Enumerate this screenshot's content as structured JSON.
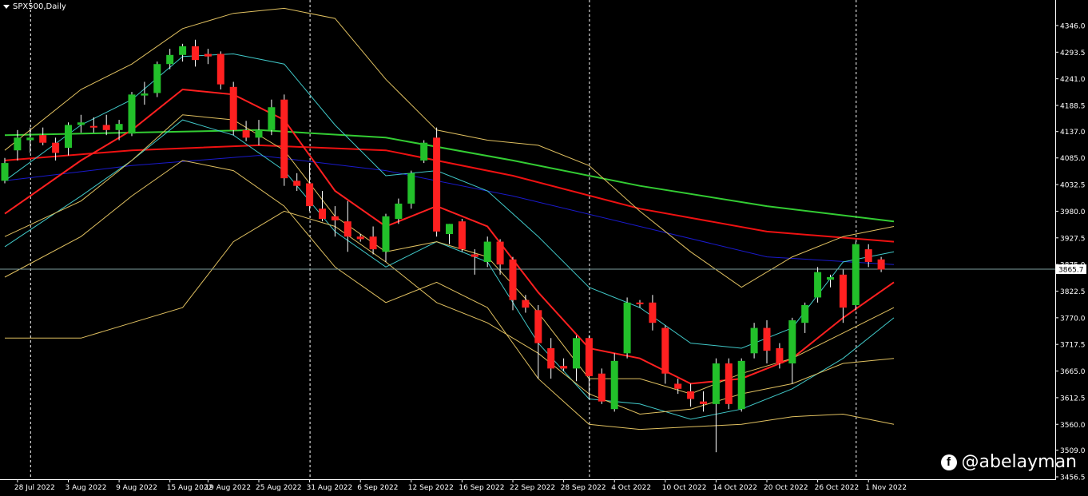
{
  "window": {
    "title": "SPX500,Daily"
  },
  "watermark": {
    "platform_icon": "facebook-icon",
    "handle": "@abelayman"
  },
  "colors": {
    "background": "#000000",
    "axis": "#ffffff",
    "grid": "#ffffff",
    "bull": "#22c02a",
    "bear": "#ff2020",
    "ma_green": "#33cc33",
    "ma_red": "#ee1111",
    "ma_blue": "#1a1acc",
    "bb_outer": "#e0c060",
    "bb_inner": "#40c8c8",
    "bb_mid": "#ff2020",
    "price_line": "#7fa0a0"
  },
  "chart_data": {
    "type": "candlestick",
    "symbol": "SPX500",
    "timeframe": "Daily",
    "ylim": [
      3456.5,
      4390
    ],
    "y_ticks": [
      "4346.0",
      "4293.5",
      "4241.0",
      "4188.5",
      "4137.0",
      "4085.0",
      "4032.5",
      "3980.0",
      "3927.5",
      "3875.0",
      "3822.5",
      "3770.0",
      "3717.5",
      "3665.0",
      "3612.5",
      "3560.0",
      "3509.0",
      "3456.5"
    ],
    "current_price": "3865.7",
    "x_labels": [
      "28 Jul 2022",
      "3 Aug 2022",
      "9 Aug 2022",
      "15 Aug 2022",
      "19 Aug 2022",
      "25 Aug 2022",
      "31 Aug 2022",
      "6 Sep 2022",
      "12 Sep 2022",
      "16 Sep 2022",
      "22 Sep 2022",
      "28 Sep 2022",
      "4 Oct 2022",
      "10 Oct 2022",
      "14 Oct 2022",
      "20 Oct 2022",
      "26 Oct 2022",
      "1 Nov 2022"
    ],
    "x_label_bar_index": [
      1,
      5,
      9,
      13,
      16,
      20,
      24,
      28,
      32,
      36,
      40,
      44,
      48,
      52,
      56,
      60,
      64,
      68
    ],
    "period_separators_bar_index": [
      2,
      24,
      46,
      67
    ],
    "candles": [
      {
        "o": 4040,
        "h": 4085,
        "l": 4035,
        "c": 4075
      },
      {
        "o": 4100,
        "h": 4140,
        "l": 4080,
        "c": 4125
      },
      {
        "o": 4120,
        "h": 4145,
        "l": 4095,
        "c": 4125
      },
      {
        "o": 4130,
        "h": 4145,
        "l": 4110,
        "c": 4115
      },
      {
        "o": 4115,
        "h": 4125,
        "l": 4080,
        "c": 4095
      },
      {
        "o": 4105,
        "h": 4155,
        "l": 4090,
        "c": 4150
      },
      {
        "o": 4150,
        "h": 4170,
        "l": 4135,
        "c": 4155
      },
      {
        "o": 4148,
        "h": 4165,
        "l": 4135,
        "c": 4145
      },
      {
        "o": 4150,
        "h": 4170,
        "l": 4130,
        "c": 4140
      },
      {
        "o": 4140,
        "h": 4160,
        "l": 4120,
        "c": 4152
      },
      {
        "o": 4133,
        "h": 4215,
        "l": 4128,
        "c": 4210
      },
      {
        "o": 4208,
        "h": 4235,
        "l": 4190,
        "c": 4212
      },
      {
        "o": 4213,
        "h": 4275,
        "l": 4205,
        "c": 4270
      },
      {
        "o": 4270,
        "h": 4300,
        "l": 4260,
        "c": 4288
      },
      {
        "o": 4288,
        "h": 4310,
        "l": 4275,
        "c": 4305
      },
      {
        "o": 4305,
        "h": 4318,
        "l": 4265,
        "c": 4278
      },
      {
        "o": 4290,
        "h": 4300,
        "l": 4270,
        "c": 4285
      },
      {
        "o": 4290,
        "h": 4295,
        "l": 4220,
        "c": 4230
      },
      {
        "o": 4225,
        "h": 4235,
        "l": 4130,
        "c": 4140
      },
      {
        "o": 4140,
        "h": 4158,
        "l": 4118,
        "c": 4125
      },
      {
        "o": 4125,
        "h": 4160,
        "l": 4110,
        "c": 4140
      },
      {
        "o": 4140,
        "h": 4200,
        "l": 4130,
        "c": 4185
      },
      {
        "o": 4200,
        "h": 4210,
        "l": 4030,
        "c": 4045
      },
      {
        "o": 4040,
        "h": 4055,
        "l": 4020,
        "c": 4030
      },
      {
        "o": 4035,
        "h": 4075,
        "l": 3980,
        "c": 3990
      },
      {
        "o": 3985,
        "h": 4020,
        "l": 3960,
        "c": 3965
      },
      {
        "o": 3970,
        "h": 3990,
        "l": 3930,
        "c": 3962
      },
      {
        "o": 3960,
        "h": 4000,
        "l": 3900,
        "c": 3930
      },
      {
        "o": 3930,
        "h": 3935,
        "l": 3920,
        "c": 3925
      },
      {
        "o": 3930,
        "h": 3950,
        "l": 3895,
        "c": 3905
      },
      {
        "o": 3900,
        "h": 3975,
        "l": 3880,
        "c": 3970
      },
      {
        "o": 3965,
        "h": 4005,
        "l": 3955,
        "c": 3995
      },
      {
        "o": 3995,
        "h": 4060,
        "l": 3985,
        "c": 4055
      },
      {
        "o": 4080,
        "h": 4120,
        "l": 4075,
        "c": 4115
      },
      {
        "o": 4125,
        "h": 4145,
        "l": 3930,
        "c": 3940
      },
      {
        "o": 3935,
        "h": 3955,
        "l": 3915,
        "c": 3955
      },
      {
        "o": 3960,
        "h": 3965,
        "l": 3900,
        "c": 3905
      },
      {
        "o": 3895,
        "h": 3905,
        "l": 3855,
        "c": 3890
      },
      {
        "o": 3880,
        "h": 3930,
        "l": 3870,
        "c": 3920
      },
      {
        "o": 3920,
        "h": 3925,
        "l": 3855,
        "c": 3875
      },
      {
        "o": 3885,
        "h": 3890,
        "l": 3785,
        "c": 3805
      },
      {
        "o": 3805,
        "h": 3815,
        "l": 3780,
        "c": 3790
      },
      {
        "o": 3785,
        "h": 3795,
        "l": 3650,
        "c": 3720
      },
      {
        "o": 3710,
        "h": 3730,
        "l": 3650,
        "c": 3670
      },
      {
        "o": 3675,
        "h": 3690,
        "l": 3665,
        "c": 3670
      },
      {
        "o": 3670,
        "h": 3735,
        "l": 3645,
        "c": 3730
      },
      {
        "o": 3730,
        "h": 3735,
        "l": 3610,
        "c": 3655
      },
      {
        "o": 3660,
        "h": 3670,
        "l": 3600,
        "c": 3605
      },
      {
        "o": 3590,
        "h": 3700,
        "l": 3585,
        "c": 3685
      },
      {
        "o": 3700,
        "h": 3810,
        "l": 3690,
        "c": 3800
      },
      {
        "o": 3800,
        "h": 3805,
        "l": 3790,
        "c": 3798
      },
      {
        "o": 3800,
        "h": 3815,
        "l": 3745,
        "c": 3760
      },
      {
        "o": 3750,
        "h": 3755,
        "l": 3640,
        "c": 3660
      },
      {
        "o": 3640,
        "h": 3650,
        "l": 3620,
        "c": 3630
      },
      {
        "o": 3625,
        "h": 3640,
        "l": 3595,
        "c": 3610
      },
      {
        "o": 3605,
        "h": 3625,
        "l": 3585,
        "c": 3600
      },
      {
        "o": 3600,
        "h": 3690,
        "l": 3505,
        "c": 3680
      },
      {
        "o": 3680,
        "h": 3690,
        "l": 3590,
        "c": 3600
      },
      {
        "o": 3590,
        "h": 3690,
        "l": 3585,
        "c": 3685
      },
      {
        "o": 3700,
        "h": 3760,
        "l": 3690,
        "c": 3750
      },
      {
        "o": 3750,
        "h": 3765,
        "l": 3680,
        "c": 3705
      },
      {
        "o": 3710,
        "h": 3720,
        "l": 3670,
        "c": 3680
      },
      {
        "o": 3680,
        "h": 3770,
        "l": 3640,
        "c": 3765
      },
      {
        "o": 3760,
        "h": 3800,
        "l": 3740,
        "c": 3795
      },
      {
        "o": 3810,
        "h": 3870,
        "l": 3800,
        "c": 3860
      },
      {
        "o": 3845,
        "h": 3855,
        "l": 3830,
        "c": 3850
      },
      {
        "o": 3855,
        "h": 3865,
        "l": 3760,
        "c": 3790
      },
      {
        "o": 3795,
        "h": 3920,
        "l": 3785,
        "c": 3915
      },
      {
        "o": 3905,
        "h": 3915,
        "l": 3870,
        "c": 3880
      },
      {
        "o": 3885,
        "h": 3890,
        "l": 3860,
        "c": 3865
      }
    ],
    "indicators": {
      "ma_green": {
        "bars": [
          0,
          10,
          20,
          30,
          40,
          50,
          60,
          70
        ],
        "values": [
          4130,
          4135,
          4140,
          4125,
          4080,
          4030,
          3990,
          3960
        ]
      },
      "ma_red_long": {
        "bars": [
          0,
          10,
          20,
          30,
          40,
          50,
          60,
          70
        ],
        "values": [
          4080,
          4100,
          4110,
          4100,
          4050,
          3985,
          3940,
          3920
        ]
      },
      "ma_blue": {
        "bars": [
          0,
          10,
          20,
          30,
          40,
          50,
          60,
          70
        ],
        "values": [
          4040,
          4070,
          4090,
          4060,
          4010,
          3950,
          3890,
          3875
        ]
      },
      "bb_mid": {
        "bars": [
          0,
          6,
          10,
          14,
          18,
          22,
          26,
          30,
          34,
          38,
          42,
          46,
          50,
          54,
          58,
          62,
          66,
          70
        ],
        "values": [
          3975,
          4080,
          4140,
          4220,
          4210,
          4160,
          4020,
          3950,
          3990,
          3950,
          3820,
          3710,
          3690,
          3640,
          3650,
          3690,
          3770,
          3840
        ]
      },
      "bb_up_inner": {
        "bars": [
          0,
          6,
          10,
          14,
          18,
          22,
          26,
          30,
          34,
          38,
          42,
          46,
          50,
          54,
          58,
          62,
          66,
          70
        ],
        "values": [
          4040,
          4150,
          4200,
          4285,
          4290,
          4270,
          4150,
          4050,
          4060,
          4020,
          3930,
          3830,
          3790,
          3720,
          3710,
          3750,
          3880,
          3900
        ]
      },
      "bb_lo_inner": {
        "bars": [
          0,
          6,
          10,
          14,
          18,
          22,
          26,
          30,
          34,
          38,
          42,
          46,
          50,
          54,
          58,
          62,
          66,
          70
        ],
        "values": [
          3910,
          4010,
          4080,
          4160,
          4130,
          4060,
          3940,
          3870,
          3920,
          3880,
          3720,
          3610,
          3600,
          3570,
          3590,
          3630,
          3690,
          3770
        ]
      },
      "bb_up_outer": {
        "bars": [
          0,
          6,
          10,
          14,
          18,
          22,
          26,
          30,
          34,
          38,
          42,
          46,
          50,
          54,
          58,
          62,
          66,
          70
        ],
        "values": [
          4100,
          4220,
          4270,
          4340,
          4370,
          4380,
          4360,
          4240,
          4140,
          4120,
          4110,
          4070,
          3980,
          3900,
          3830,
          3890,
          3930,
          3950
        ]
      },
      "bb_lo_outer": {
        "bars": [
          0,
          6,
          10,
          14,
          18,
          22,
          26,
          30,
          34,
          38,
          42,
          46,
          50,
          54,
          58,
          62,
          66,
          70
        ],
        "values": [
          3850,
          3930,
          4010,
          4080,
          4060,
          3990,
          3870,
          3800,
          3840,
          3790,
          3650,
          3560,
          3550,
          3555,
          3560,
          3575,
          3580,
          3560
        ]
      },
      "env_up": {
        "bars": [
          0,
          6,
          10,
          14,
          18,
          22,
          26,
          30,
          34,
          38,
          42,
          46,
          50,
          54,
          58,
          62,
          66,
          70
        ],
        "values": [
          3930,
          4000,
          4080,
          4170,
          4160,
          4100,
          3970,
          3900,
          3920,
          3890,
          3780,
          3650,
          3650,
          3620,
          3660,
          3690,
          3740,
          3790
        ]
      },
      "env_lo": {
        "bars": [
          0,
          6,
          10,
          14,
          18,
          22,
          26,
          30,
          34,
          38,
          42,
          46,
          50,
          54,
          58,
          62,
          66,
          70
        ],
        "values": [
          3730,
          3730,
          3760,
          3790,
          3920,
          3980,
          3950,
          3880,
          3800,
          3760,
          3700,
          3620,
          3580,
          3590,
          3620,
          3640,
          3680,
          3690
        ]
      }
    }
  }
}
